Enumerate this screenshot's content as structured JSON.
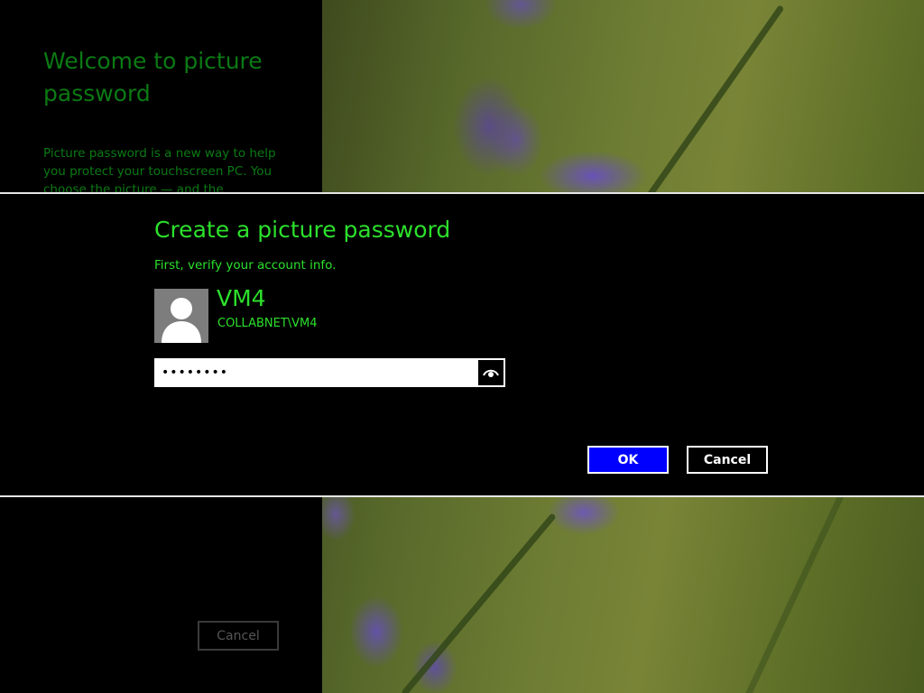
{
  "background": {
    "welcome_title": "Welcome to picture password",
    "welcome_body": "Picture password is a new way to help you protect your touchscreen PC. You choose the picture — and the gestures",
    "cancel_label": "Cancel"
  },
  "dialog": {
    "title": "Create a picture password",
    "subtitle": "First, verify your account info.",
    "account": {
      "name": "VM4",
      "domain": "COLLABNET\\VM4"
    },
    "password": {
      "value": "••••••••"
    },
    "ok_label": "OK",
    "cancel_label": "Cancel"
  },
  "icons": {
    "avatar": "user-avatar-icon",
    "reveal": "eye-icon"
  },
  "colors": {
    "accent_text": "#2ce02c",
    "dim_text": "#0b7a14",
    "ok_button": "#0000ff",
    "dialog_bg": "#000000"
  }
}
